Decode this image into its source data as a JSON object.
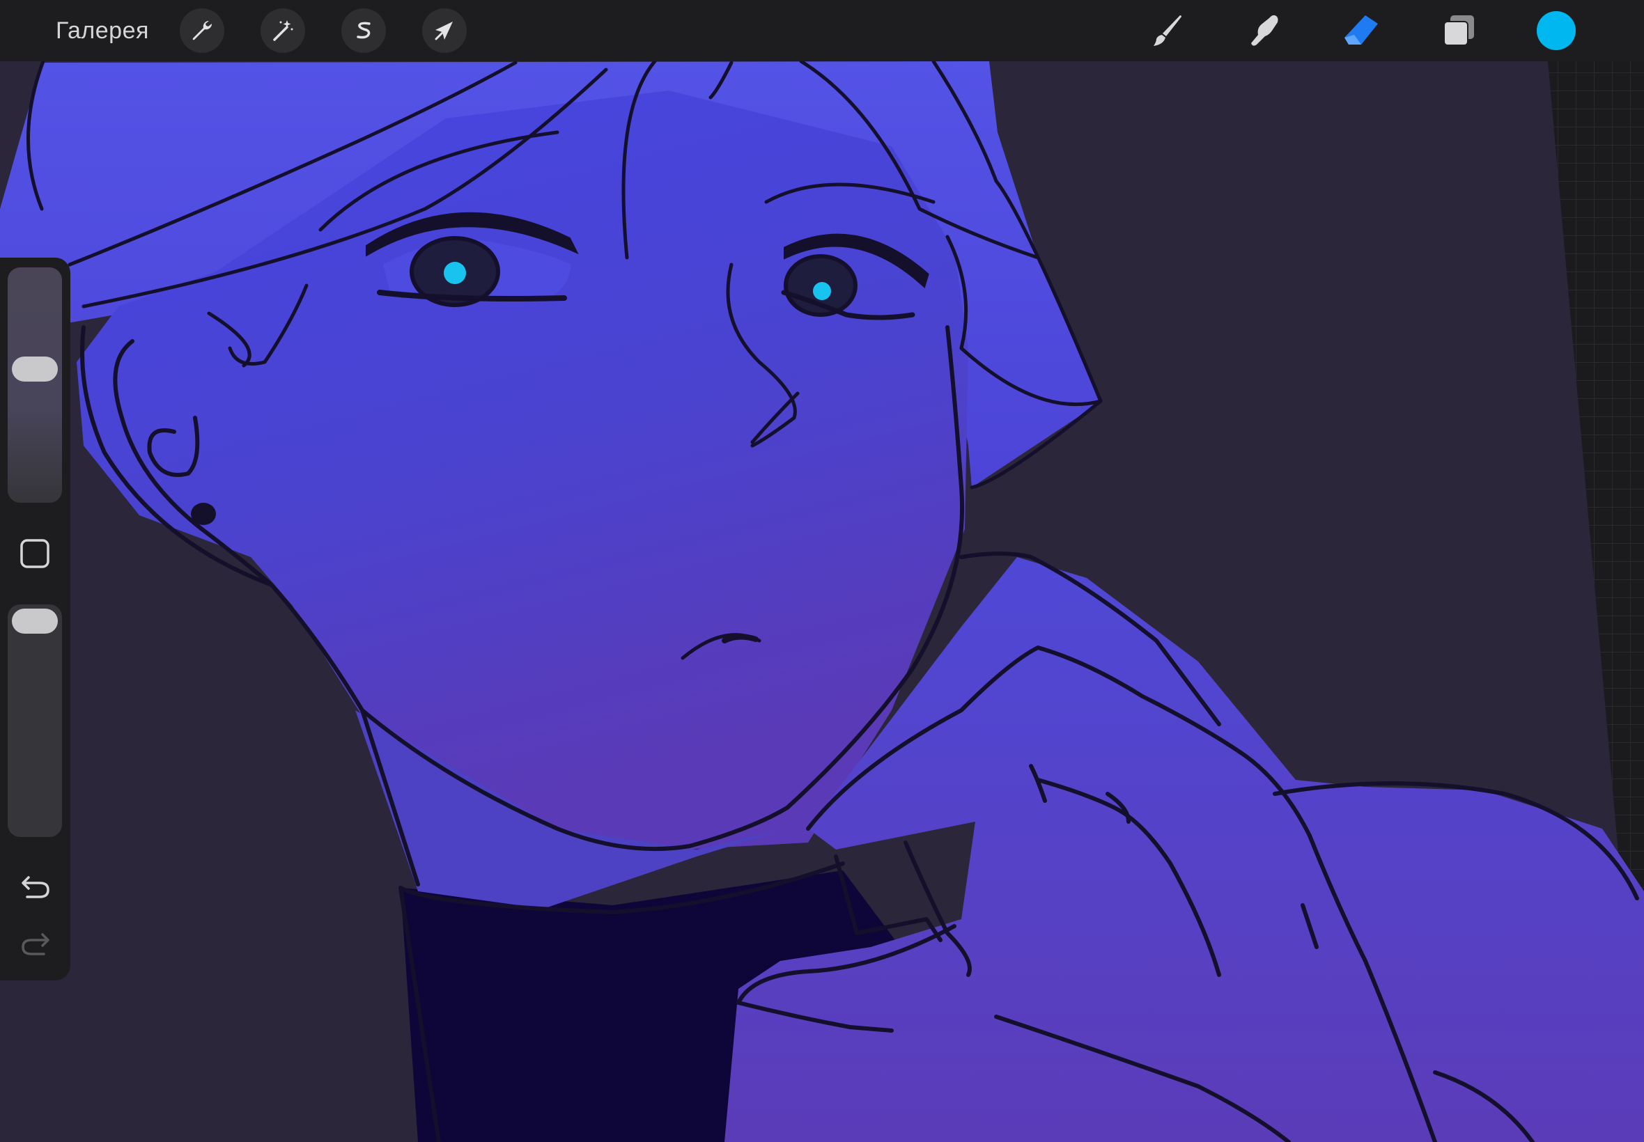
{
  "app": {
    "gallery_label": "Галерея"
  },
  "toolbar_left": {
    "icons": [
      "wrench-icon",
      "magic-wand-icon",
      "selection-s-icon",
      "arrow-cursor-icon"
    ]
  },
  "toolbar_right": {
    "icons": [
      "brush-icon",
      "smudge-icon",
      "eraser-icon",
      "layers-icon"
    ],
    "active_tool": "eraser",
    "active_color": "#00b7f0",
    "accent_color": "#1e7bf2"
  },
  "sidebar": {
    "brush_size_level": 0.58,
    "brush_opacity_level": 1.0,
    "icons": [
      "modify-square-icon",
      "undo-icon",
      "redo-icon"
    ],
    "redo_enabled": false
  },
  "colors": {
    "bar_background": "#1d1d1f",
    "canvas_background": "#2b2639",
    "skin_top": "#4746e0",
    "skin_bottom": "#5a3bb4",
    "sweater": "#10063a",
    "line": "#14102c",
    "eye_highlight": "#19c3f0"
  }
}
